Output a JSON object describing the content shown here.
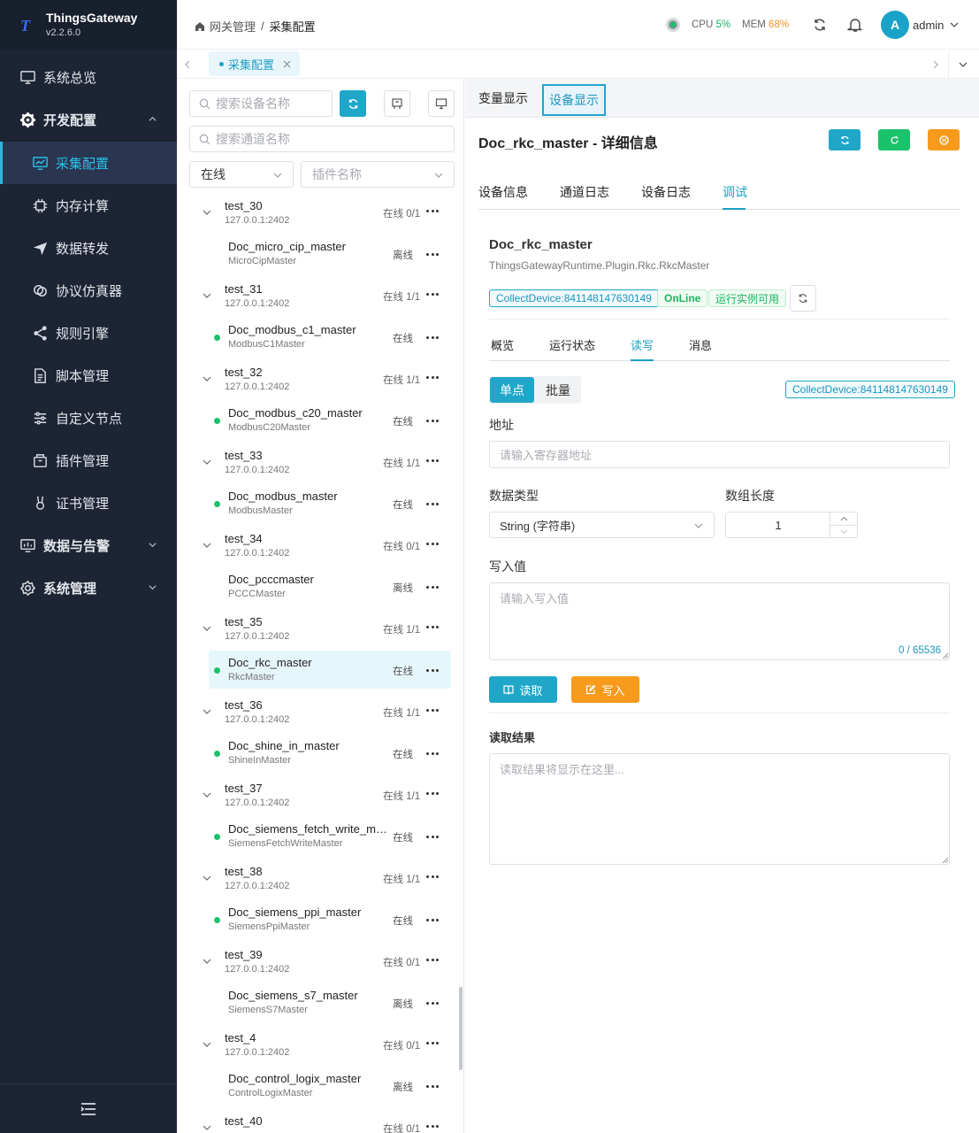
{
  "app": {
    "name": "ThingsGateway",
    "version": "v2.2.6.0"
  },
  "sidebar": {
    "items": [
      {
        "label": "系统总览",
        "icon": "monitor-icon"
      },
      {
        "label": "开发配置",
        "icon": "gear-icon"
      },
      {
        "label": "采集配置",
        "icon": "chart-board-icon"
      },
      {
        "label": "内存计算",
        "icon": "chip-icon"
      },
      {
        "label": "数据转发",
        "icon": "send-icon"
      },
      {
        "label": "协议仿真器",
        "icon": "link-icon"
      },
      {
        "label": "规则引擎",
        "icon": "share-icon"
      },
      {
        "label": "脚本管理",
        "icon": "document-icon"
      },
      {
        "label": "自定义节点",
        "icon": "sliders-icon"
      },
      {
        "label": "插件管理",
        "icon": "box-icon"
      },
      {
        "label": "证书管理",
        "icon": "certificate-icon"
      },
      {
        "label": "数据与告警",
        "icon": "alarm-icon"
      },
      {
        "label": "系统管理",
        "icon": "settings-icon"
      }
    ]
  },
  "header": {
    "breadcrumb": [
      "网关管理",
      "/",
      "采集配置"
    ],
    "cpu_label": "CPU",
    "cpu_value": "5%",
    "mem_label": "MEM",
    "mem_value": "68%",
    "user_initial": "A",
    "user_name": "admin"
  },
  "tabs": {
    "active": "采集配置"
  },
  "left": {
    "device_search_placeholder": "搜索设备名称",
    "channel_search_placeholder": "搜索通道名称",
    "status_filter": "在线",
    "plugin_filter_placeholder": "插件名称",
    "groups": [
      {
        "name": "test_30",
        "ip": "127.0.0.1:2402",
        "count": "在线 0/1",
        "device": {
          "name": "Doc_micro_cip_master",
          "type": "MicroCipMaster",
          "status": "离线",
          "online": false
        }
      },
      {
        "name": "test_31",
        "ip": "127.0.0.1:2402",
        "count": "在线 1/1",
        "device": {
          "name": "Doc_modbus_c1_master",
          "type": "ModbusC1Master",
          "status": "在线",
          "online": true
        }
      },
      {
        "name": "test_32",
        "ip": "127.0.0.1:2402",
        "count": "在线 1/1",
        "device": {
          "name": "Doc_modbus_c20_master",
          "type": "ModbusC20Master",
          "status": "在线",
          "online": true
        }
      },
      {
        "name": "test_33",
        "ip": "127.0.0.1:2402",
        "count": "在线 1/1",
        "device": {
          "name": "Doc_modbus_master",
          "type": "ModbusMaster",
          "status": "在线",
          "online": true
        }
      },
      {
        "name": "test_34",
        "ip": "127.0.0.1:2402",
        "count": "在线 0/1",
        "device": {
          "name": "Doc_pcccmaster",
          "type": "PCCCMaster",
          "status": "离线",
          "online": false
        }
      },
      {
        "name": "test_35",
        "ip": "127.0.0.1:2402",
        "count": "在线 1/1",
        "device": {
          "name": "Doc_rkc_master",
          "type": "RkcMaster",
          "status": "在线",
          "online": true,
          "selected": true
        }
      },
      {
        "name": "test_36",
        "ip": "127.0.0.1:2402",
        "count": "在线 1/1",
        "device": {
          "name": "Doc_shine_in_master",
          "type": "ShineInMaster",
          "status": "在线",
          "online": true
        }
      },
      {
        "name": "test_37",
        "ip": "127.0.0.1:2402",
        "count": "在线 1/1",
        "device": {
          "name": "Doc_siemens_fetch_write_master",
          "type": "SiemensFetchWriteMaster",
          "status": "在线",
          "online": true
        }
      },
      {
        "name": "test_38",
        "ip": "127.0.0.1:2402",
        "count": "在线 1/1",
        "device": {
          "name": "Doc_siemens_ppi_master",
          "type": "SiemensPpiMaster",
          "status": "在线",
          "online": true
        }
      },
      {
        "name": "test_39",
        "ip": "127.0.0.1:2402",
        "count": "在线 0/1",
        "device": {
          "name": "Doc_siemens_s7_master",
          "type": "SiemensS7Master",
          "status": "离线",
          "online": false
        }
      },
      {
        "name": "test_4",
        "ip": "127.0.0.1:2402",
        "count": "在线 0/1",
        "device": {
          "name": "Doc_control_logix_master",
          "type": "ControlLogixMaster",
          "status": "离线",
          "online": false
        }
      },
      {
        "name": "test_40",
        "ip": "",
        "count": "在线 0/1",
        "device": null
      }
    ]
  },
  "right": {
    "top_tabs": [
      "变量显示",
      "设备显示"
    ],
    "title": "Doc_rkc_master - 详细信息",
    "sub_tabs": [
      "设备信息",
      "通道日志",
      "设备日志",
      "调试"
    ],
    "device_name": "Doc_rkc_master",
    "plugin_full_name": "ThingsGatewayRuntime.Plugin.Rkc.RkcMaster",
    "tags": {
      "collect": "CollectDevice:841148147630149",
      "online": "OnLine",
      "runtime": "运行实例可用"
    },
    "inner_tabs": [
      "概览",
      "运行状态",
      "读写",
      "消息"
    ],
    "mode_tabs": [
      "单点",
      "批量"
    ],
    "collect_tag": "CollectDevice:841148147630149",
    "address_label": "地址",
    "address_placeholder": "请输入寄存器地址",
    "datatype_label": "数据类型",
    "datatype_value": "String (字符串)",
    "arraylen_label": "数组长度",
    "arraylen_value": "1",
    "write_label": "写入值",
    "write_placeholder": "请输入写入值",
    "write_counter": "0 / 65536",
    "read_button": "读取",
    "write_button": "写入",
    "result_label": "读取结果",
    "result_placeholder": "读取结果将显示在这里..."
  },
  "colors": {
    "accent": "#1fa6c9",
    "green": "#19c26b",
    "orange": "#f89a1c",
    "sidebar": "#1d2433"
  }
}
